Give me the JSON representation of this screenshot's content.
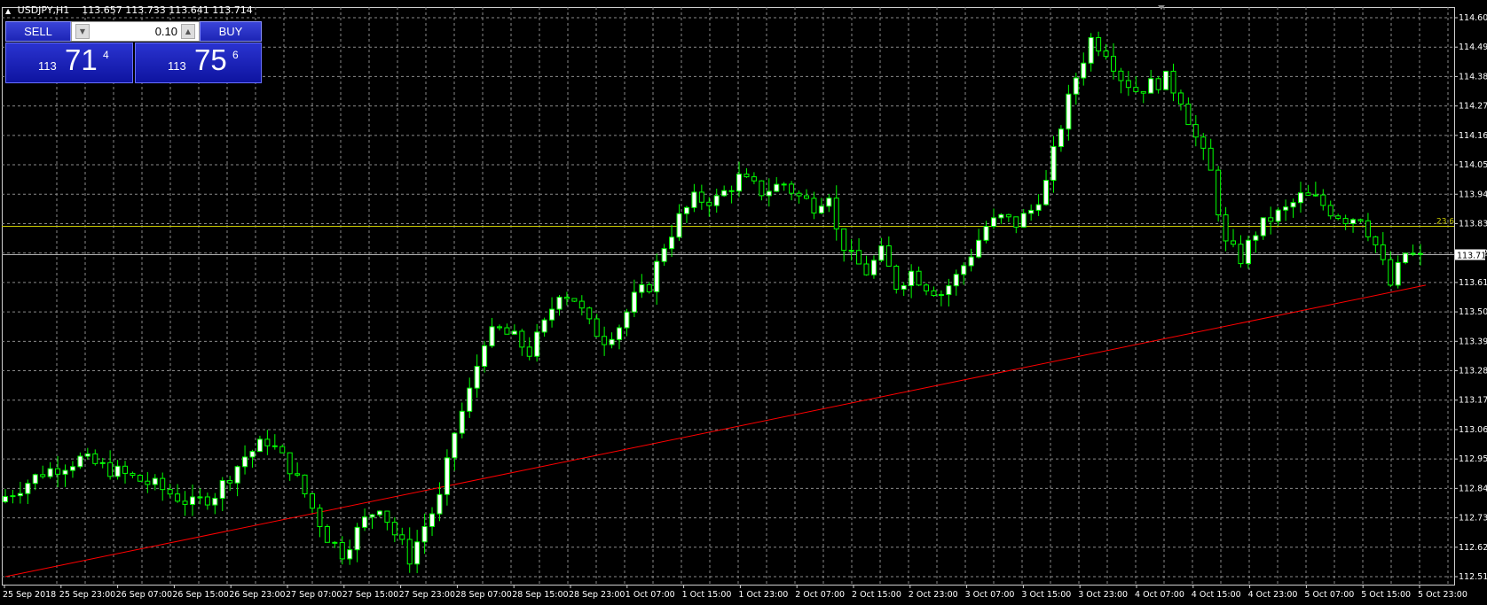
{
  "header": {
    "symbol": "USDJPY,H1",
    "ohlc": "113.657 113.733 113.641 113.714"
  },
  "one_click": {
    "sell_label": "SELL",
    "buy_label": "BUY",
    "lot": "0.10",
    "sell_price": {
      "small": "113",
      "big": "71",
      "sup": "4"
    },
    "buy_price": {
      "small": "113",
      "big": "75",
      "sup": "6"
    }
  },
  "colors": {
    "background": "#000000",
    "grid": "#8a8a8a",
    "bull": "#ffffff",
    "bear": "#000000",
    "wick": "#00ff00",
    "trendline": "#ff0000",
    "fib": "#c8c800",
    "bid_line": "#b0b0b0"
  },
  "price_axis": {
    "labels": [
      "114.600",
      "114.490",
      "114.380",
      "114.270",
      "114.160",
      "114.050",
      "113.940",
      "113.830",
      "113.720",
      "113.610",
      "113.500",
      "113.390",
      "113.280",
      "113.170",
      "113.060",
      "112.950",
      "112.840",
      "112.730",
      "112.620",
      "112.510"
    ],
    "current_price": "113.714",
    "fib_label": "23.6"
  },
  "time_axis": {
    "labels": [
      "25 Sep 2018",
      "25 Sep 23:00",
      "26 Sep 07:00",
      "26 Sep 15:00",
      "26 Sep 23:00",
      "27 Sep 07:00",
      "27 Sep 15:00",
      "27 Sep 23:00",
      "28 Sep 07:00",
      "28 Sep 15:00",
      "28 Sep 23:00",
      "1 Oct 07:00",
      "1 Oct 15:00",
      "1 Oct 23:00",
      "2 Oct 07:00",
      "2 Oct 15:00",
      "2 Oct 23:00",
      "3 Oct 07:00",
      "3 Oct 15:00",
      "3 Oct 23:00",
      "4 Oct 07:00",
      "4 Oct 15:00",
      "4 Oct 23:00",
      "5 Oct 07:00",
      "5 Oct 15:00",
      "5 Oct 23:00"
    ]
  },
  "chart_data": {
    "type": "candlestick",
    "symbol": "USDJPY",
    "timeframe": "H1",
    "ylim": [
      112.51,
      114.6
    ],
    "close_path": [
      [
        0,
        112.81
      ],
      [
        5,
        112.9
      ],
      [
        10,
        112.95
      ],
      [
        15,
        112.9
      ],
      [
        20,
        112.85
      ],
      [
        25,
        112.78
      ],
      [
        28,
        112.82
      ],
      [
        32,
        112.96
      ],
      [
        35,
        113.02
      ],
      [
        38,
        112.92
      ],
      [
        40,
        112.82
      ],
      [
        43,
        112.66
      ],
      [
        45,
        112.6
      ],
      [
        48,
        112.72
      ],
      [
        50,
        112.78
      ],
      [
        52,
        112.67
      ],
      [
        54,
        112.58
      ],
      [
        56,
        112.7
      ],
      [
        58,
        112.8
      ],
      [
        60,
        113.05
      ],
      [
        62,
        113.2
      ],
      [
        64,
        113.4
      ],
      [
        66,
        113.43
      ],
      [
        68,
        113.4
      ],
      [
        70,
        113.35
      ],
      [
        72,
        113.45
      ],
      [
        74,
        113.58
      ],
      [
        76,
        113.55
      ],
      [
        78,
        113.45
      ],
      [
        80,
        113.4
      ],
      [
        82,
        113.45
      ],
      [
        84,
        113.55
      ],
      [
        86,
        113.6
      ],
      [
        88,
        113.75
      ],
      [
        90,
        113.85
      ],
      [
        92,
        113.92
      ],
      [
        95,
        113.92
      ],
      [
        98,
        114.0
      ],
      [
        101,
        113.95
      ],
      [
        104,
        113.98
      ],
      [
        106,
        113.93
      ],
      [
        108,
        113.9
      ],
      [
        110,
        113.95
      ],
      [
        111,
        113.8
      ],
      [
        113,
        113.7
      ],
      [
        115,
        113.65
      ],
      [
        117,
        113.72
      ],
      [
        119,
        113.6
      ],
      [
        121,
        113.65
      ],
      [
        123,
        113.6
      ],
      [
        125,
        113.57
      ],
      [
        127,
        113.63
      ],
      [
        129,
        113.72
      ],
      [
        131,
        113.82
      ],
      [
        133,
        113.85
      ],
      [
        135,
        113.83
      ],
      [
        137,
        113.88
      ],
      [
        139,
        113.98
      ],
      [
        141,
        114.2
      ],
      [
        143,
        114.38
      ],
      [
        145,
        114.52
      ],
      [
        147,
        114.48
      ],
      [
        149,
        114.38
      ],
      [
        151,
        114.33
      ],
      [
        153,
        114.35
      ],
      [
        155,
        114.37
      ],
      [
        157,
        114.3
      ],
      [
        159,
        114.15
      ],
      [
        161,
        114.02
      ],
      [
        163,
        113.75
      ],
      [
        165,
        113.7
      ],
      [
        167,
        113.8
      ],
      [
        169,
        113.85
      ],
      [
        171,
        113.88
      ],
      [
        173,
        113.93
      ],
      [
        175,
        113.92
      ],
      [
        177,
        113.88
      ],
      [
        179,
        113.85
      ],
      [
        181,
        113.86
      ],
      [
        183,
        113.75
      ],
      [
        185,
        113.6
      ],
      [
        187,
        113.72
      ],
      [
        189,
        113.7
      ],
      [
        190,
        113.714
      ]
    ],
    "trendline": {
      "from": {
        "x": 0,
        "y": 112.51
      },
      "to": {
        "x": 189.7,
        "y": 113.6
      }
    },
    "fib_level": {
      "label": "23.6",
      "value": 113.82
    },
    "bid": 113.714
  }
}
